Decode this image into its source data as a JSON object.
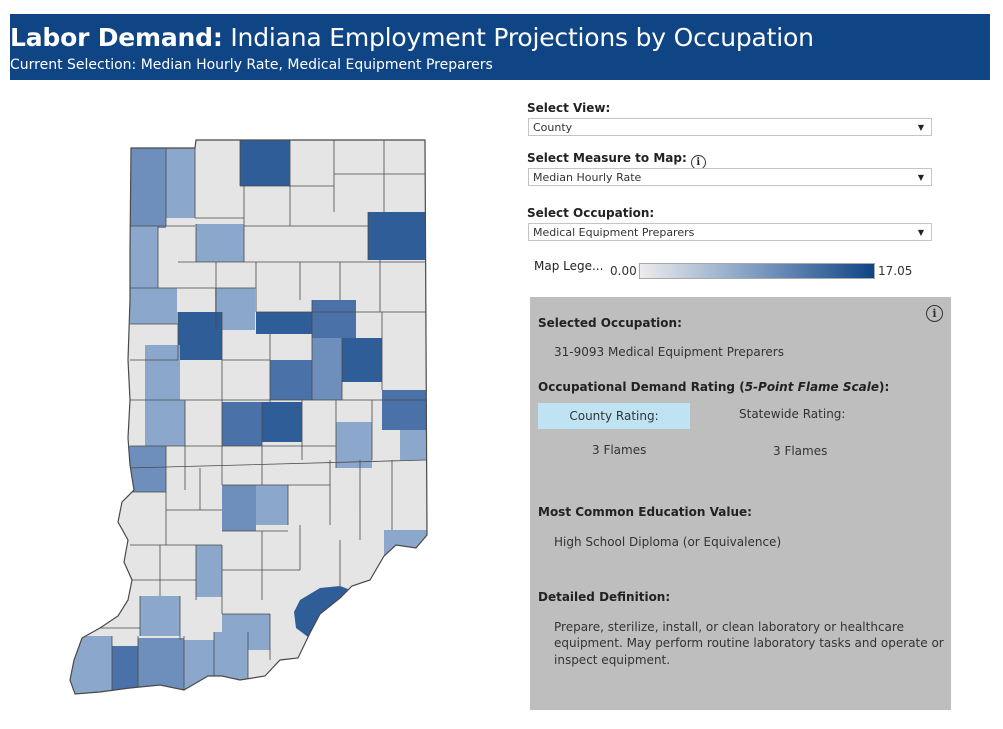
{
  "header": {
    "title_bold": "Labor Demand:",
    "title_rest": "Indiana Employment Projections by Occupation",
    "subtitle": "Current Selection: Median Hourly Rate, Medical Equipment Preparers"
  },
  "controls": {
    "view_label": "Select View:",
    "view_value": "County",
    "measure_label": "Select Measure to Map:",
    "measure_value": "Median Hourly Rate",
    "occupation_label": "Select Occupation:",
    "occupation_value": "Medical Equipment Preparers"
  },
  "legend": {
    "title": "Map Lege...",
    "min": "0.00",
    "max": "17.05",
    "colors": {
      "low": "#ececec",
      "mid": "#7d9bc2",
      "high": "#0f4584"
    }
  },
  "panel": {
    "selected_label": "Selected Occupation:",
    "selected_value": "31-9093  Medical Equipment Preparers",
    "rating_label_prefix": "Occupational Demand Rating (",
    "rating_label_emph": "5-Point Flame Scale",
    "rating_label_suffix": "):",
    "county_rating_label": "County Rating:",
    "statewide_rating_label": "Statewide Rating:",
    "county_rating_value": "3 Flames",
    "statewide_rating_value": "3 Flames",
    "education_label": "Most Common Education Value:",
    "education_value": "High School Diploma (or Equivalence)",
    "definition_label": "Detailed Definition:",
    "definition_line1": "Prepare, sterilize, install, or clean laboratory or healthcare",
    "definition_line2": "equipment.  May perform routine laboratory tasks and operate or",
    "definition_line3": "inspect equipment."
  },
  "map_colors": {
    "none": "#e5e5e5",
    "light": "#8ba7cb",
    "medium": "#6e8fbb",
    "dark": "#4b72a8",
    "darkest": "#2f5d98",
    "border": "#4a4a4a"
  }
}
